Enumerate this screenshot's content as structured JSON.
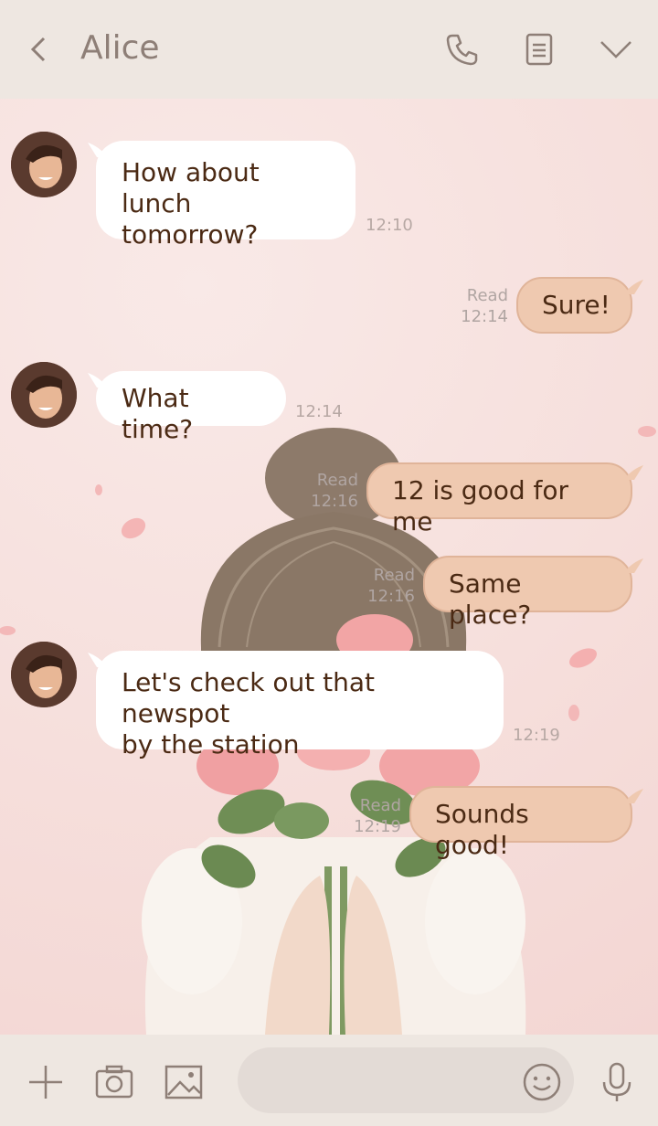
{
  "header": {
    "title": "Alice",
    "icons": [
      "back-icon",
      "phone-icon",
      "notes-icon",
      "chevron-down-icon"
    ]
  },
  "messages": [
    {
      "dir": "in",
      "text_lines": [
        "How about lunch",
        "tomorrow?"
      ],
      "time": "12:10"
    },
    {
      "dir": "out",
      "text": "Sure!",
      "read": "Read",
      "time": "12:14"
    },
    {
      "dir": "in",
      "text_lines": [
        "What time?"
      ],
      "time": "12:14"
    },
    {
      "dir": "out",
      "text": "12 is good for me",
      "read": "Read",
      "time": "12:16"
    },
    {
      "dir": "out",
      "text": "Same place?",
      "read": "Read",
      "time": "12:16"
    },
    {
      "dir": "in",
      "text_lines": [
        "Let's check out that newspot",
        "by the station"
      ],
      "time": "12:19"
    },
    {
      "dir": "out",
      "text": "Sounds good!",
      "read": "Read",
      "time": "12:19"
    }
  ],
  "footer": {
    "icons": [
      "plus-icon",
      "camera-icon",
      "image-icon",
      "emoji-icon",
      "mic-icon"
    ],
    "input_placeholder": ""
  },
  "colors": {
    "header_bg": "#eee7e1",
    "out_bubble": "#efc9b0",
    "in_bubble": "#ffffff",
    "text": "#4b2a14"
  }
}
